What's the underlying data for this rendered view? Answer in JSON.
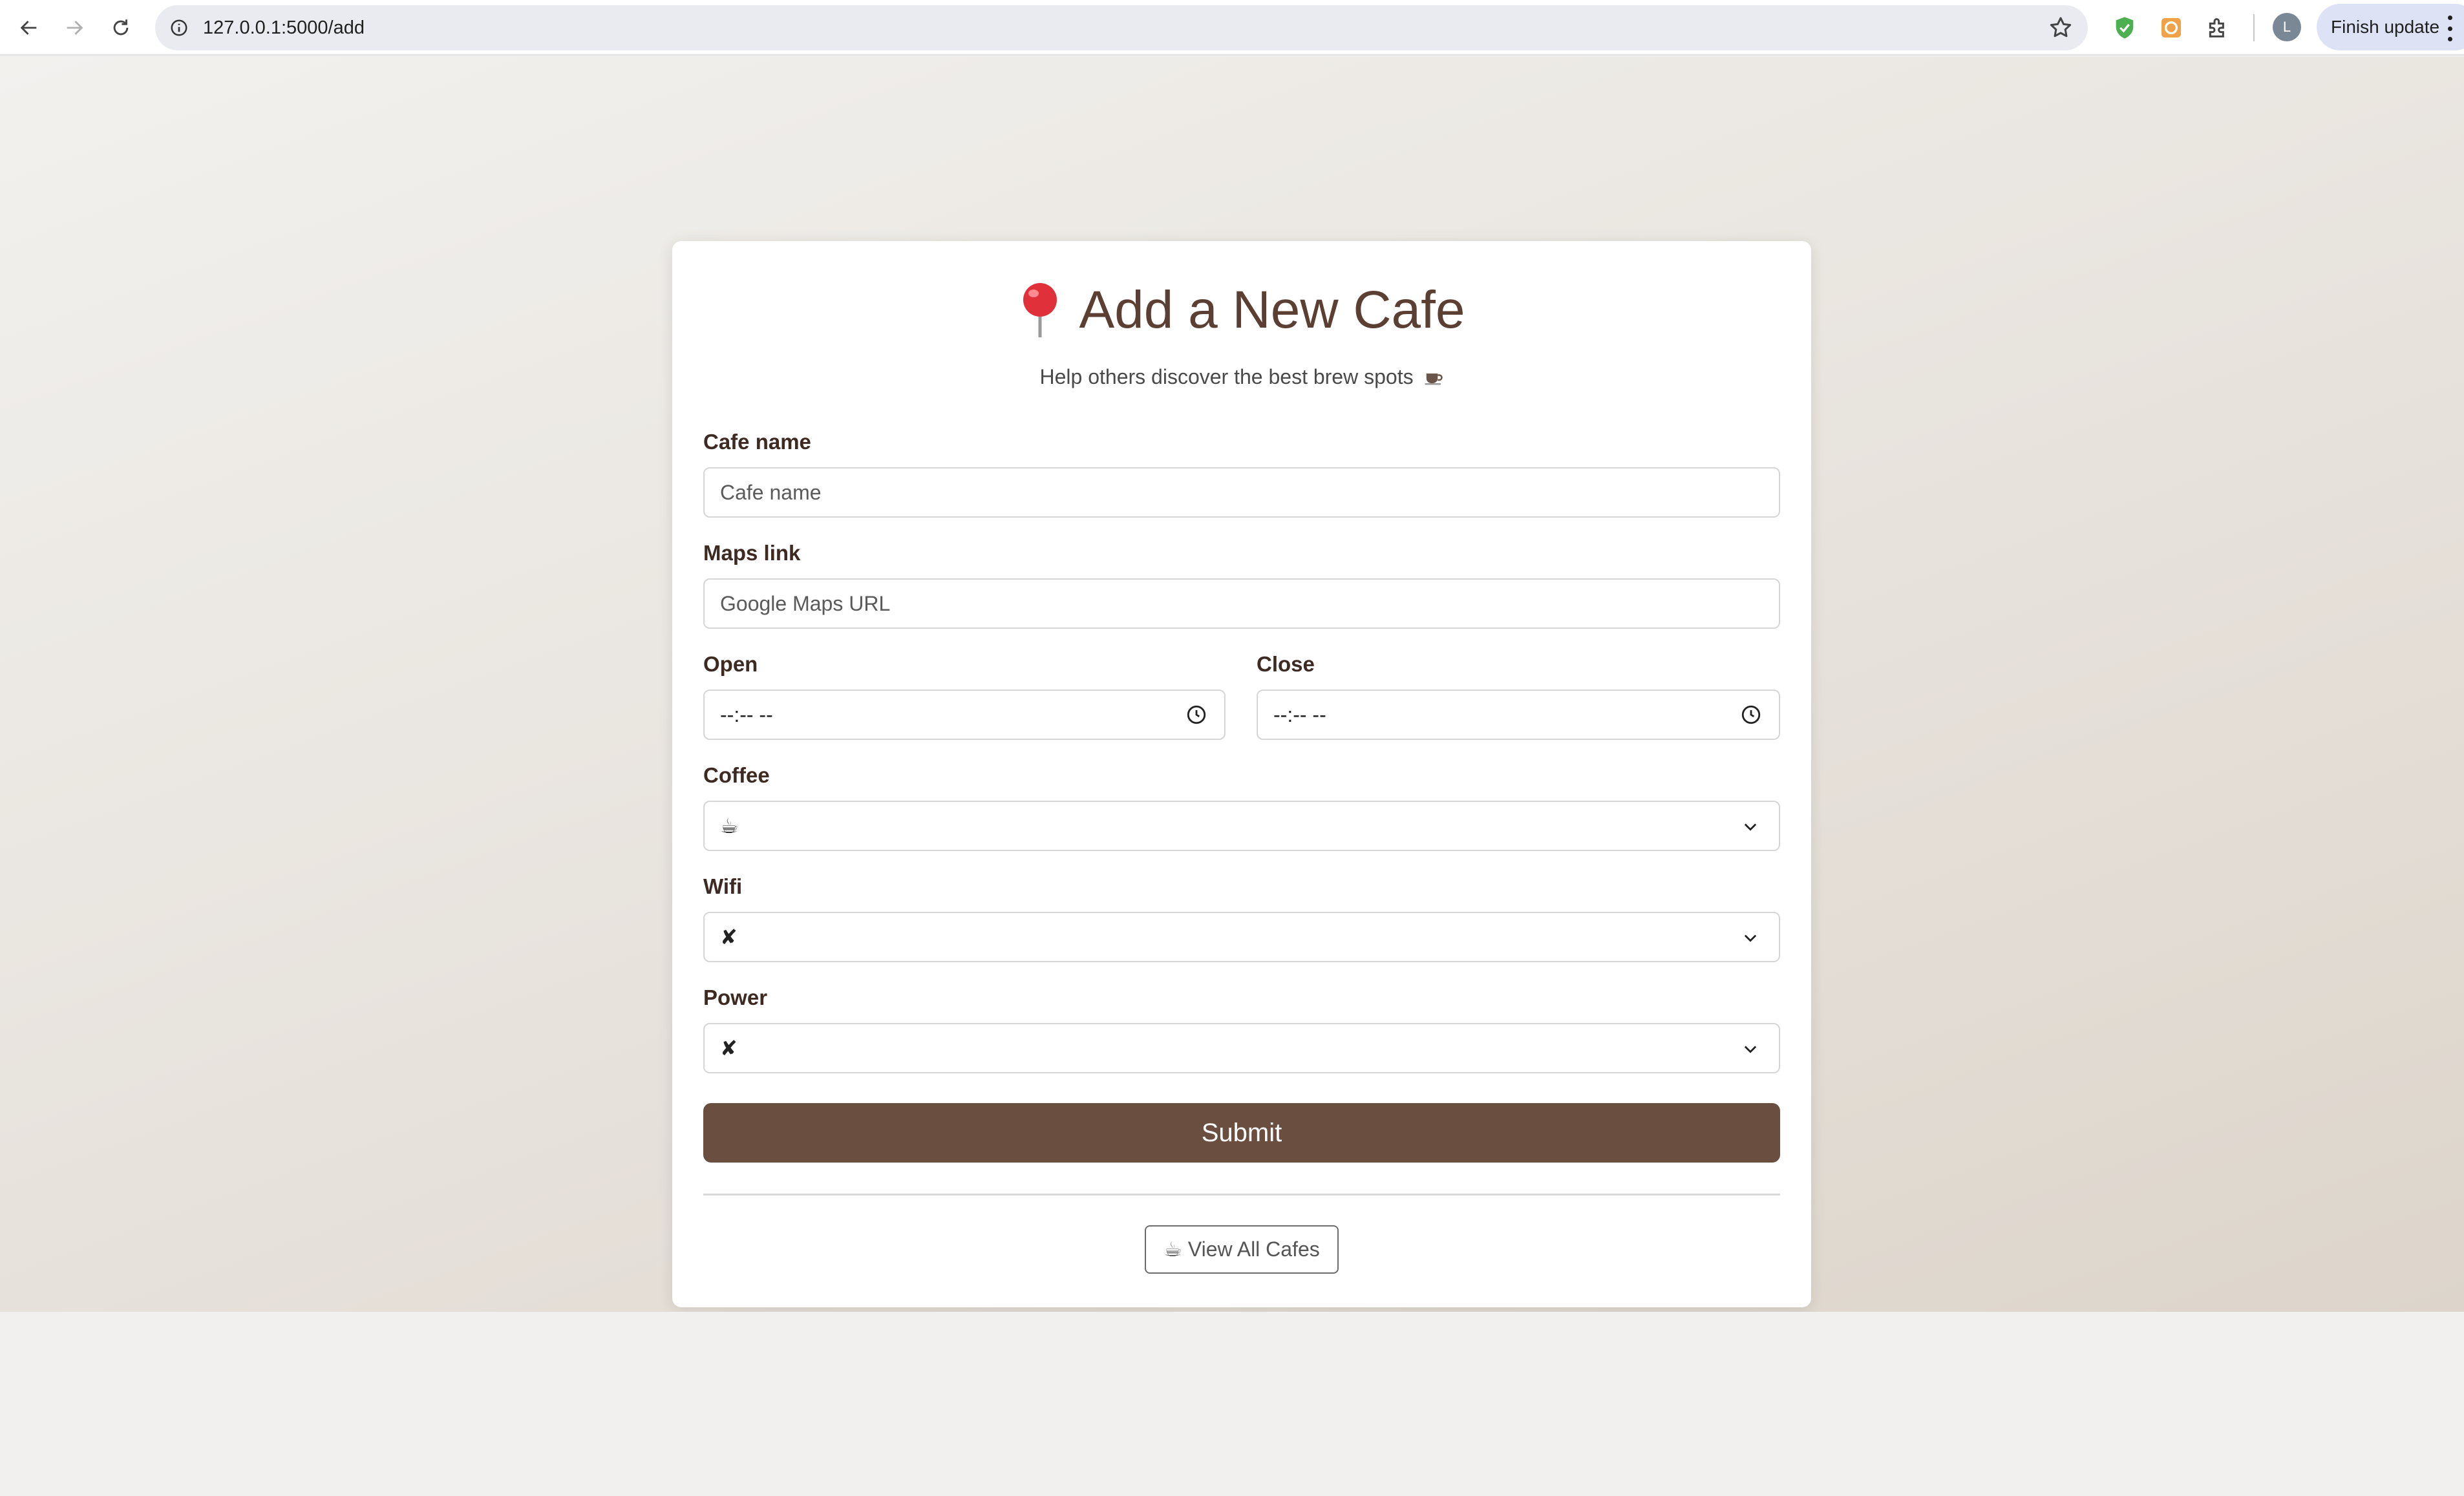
{
  "browser": {
    "url": "127.0.0.1:5000/add",
    "avatar_letter": "L",
    "update_label": "Finish update"
  },
  "card": {
    "title": "Add a New Cafe",
    "subtitle": "Help others discover the best brew spots"
  },
  "form": {
    "name_label": "Cafe name",
    "name_placeholder": "Cafe name",
    "maps_label": "Maps link",
    "maps_placeholder": "Google Maps URL",
    "open_label": "Open",
    "open_value": "--:-- --",
    "close_label": "Close",
    "close_value": "--:-- --",
    "coffee_label": "Coffee",
    "coffee_value": "☕",
    "wifi_label": "Wifi",
    "wifi_value": "✘",
    "power_label": "Power",
    "power_value": "✘",
    "submit_label": "Submit",
    "view_all_label": "View All Cafes",
    "view_all_icon": "☕"
  },
  "colors": {
    "accent": "#6a4f41",
    "title": "#5b3f33",
    "label": "#3d2a22"
  }
}
